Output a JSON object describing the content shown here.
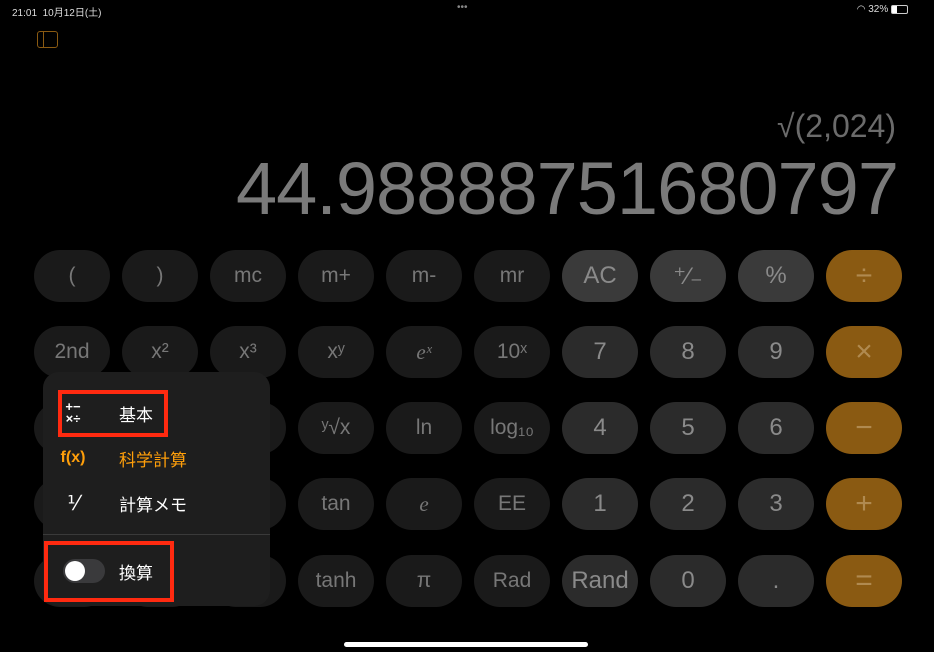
{
  "status": {
    "time": "21:01",
    "date": "10月12日(土)",
    "battery": "32%",
    "dots": "•••"
  },
  "display": {
    "expression": "√(2,024)",
    "result": "44.98888751680797"
  },
  "keys": [
    [
      "(",
      ")",
      "mc",
      "m+",
      "m-",
      "mr",
      "AC",
      "⁺∕₋",
      "%",
      "÷"
    ],
    [
      "2nd",
      "x²",
      "x³",
      "xʸ",
      "eˣ",
      "10ˣ",
      "7",
      "8",
      "9",
      "×"
    ],
    [
      "",
      "",
      "",
      "ʸ√x",
      "ln",
      "log₁₀",
      "4",
      "5",
      "6",
      "−"
    ],
    [
      "",
      "",
      "",
      "tan",
      "e",
      "EE",
      "1",
      "2",
      "3",
      "+"
    ],
    [
      "",
      "",
      "",
      "tanh",
      "π",
      "Rad",
      "Rand",
      "0",
      ".",
      "="
    ]
  ],
  "menu": {
    "items": [
      {
        "icon": "+−\n×÷",
        "label": "基本"
      },
      {
        "icon": "f(x)",
        "label": "科学計算"
      },
      {
        "icon": "y/x",
        "label": "計算メモ"
      }
    ],
    "toggle": {
      "label": "換算",
      "on": false
    }
  },
  "colors": {
    "accent": "#ff9f0a",
    "highlight": "#ff2a10"
  }
}
